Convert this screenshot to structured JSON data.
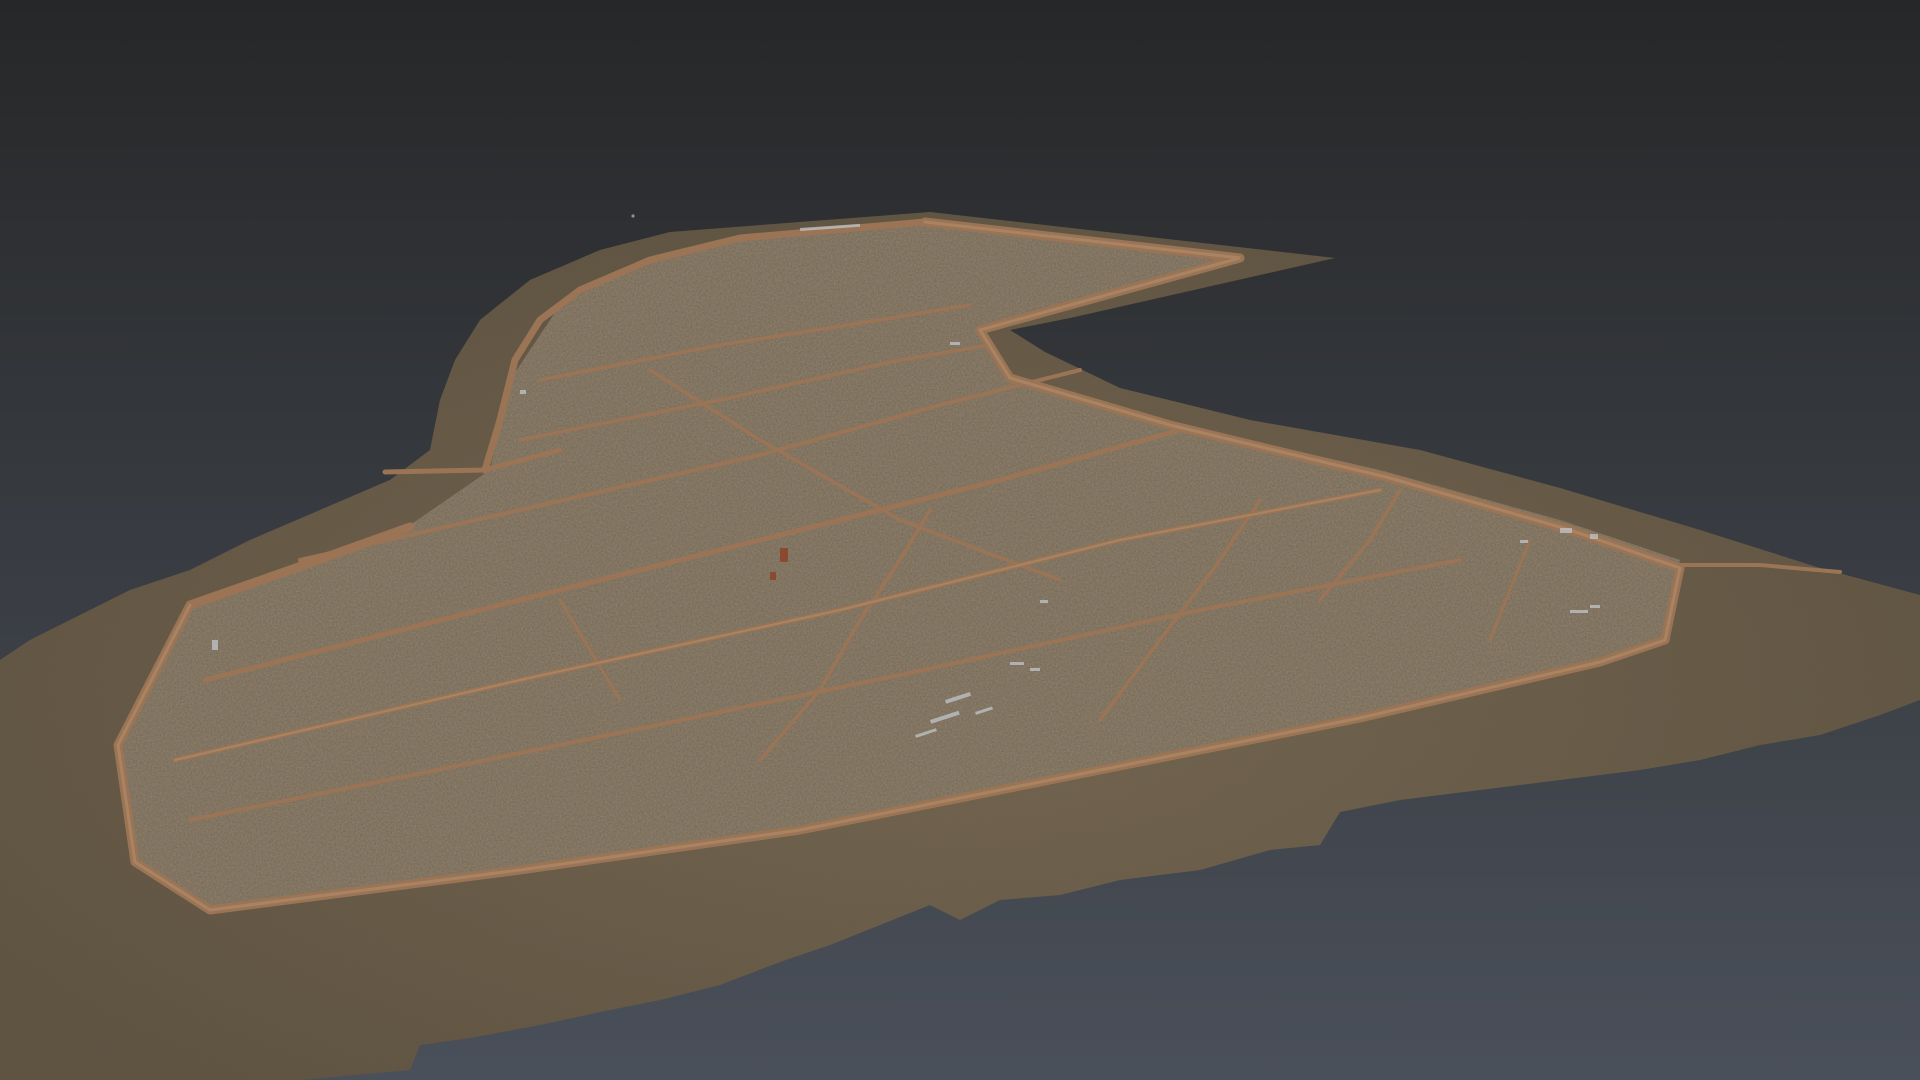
{
  "viewer": {
    "background_top": "#262728",
    "background_bottom": "#4a505a"
  },
  "terrain": {
    "vegetation_color": "#6a5a44",
    "vegetation_dark": "#4c4232",
    "plateau_color": "#7c6c57",
    "road_color": "#9a7455",
    "road_light": "#b3906f",
    "debris_color": "#c2c8cc"
  }
}
